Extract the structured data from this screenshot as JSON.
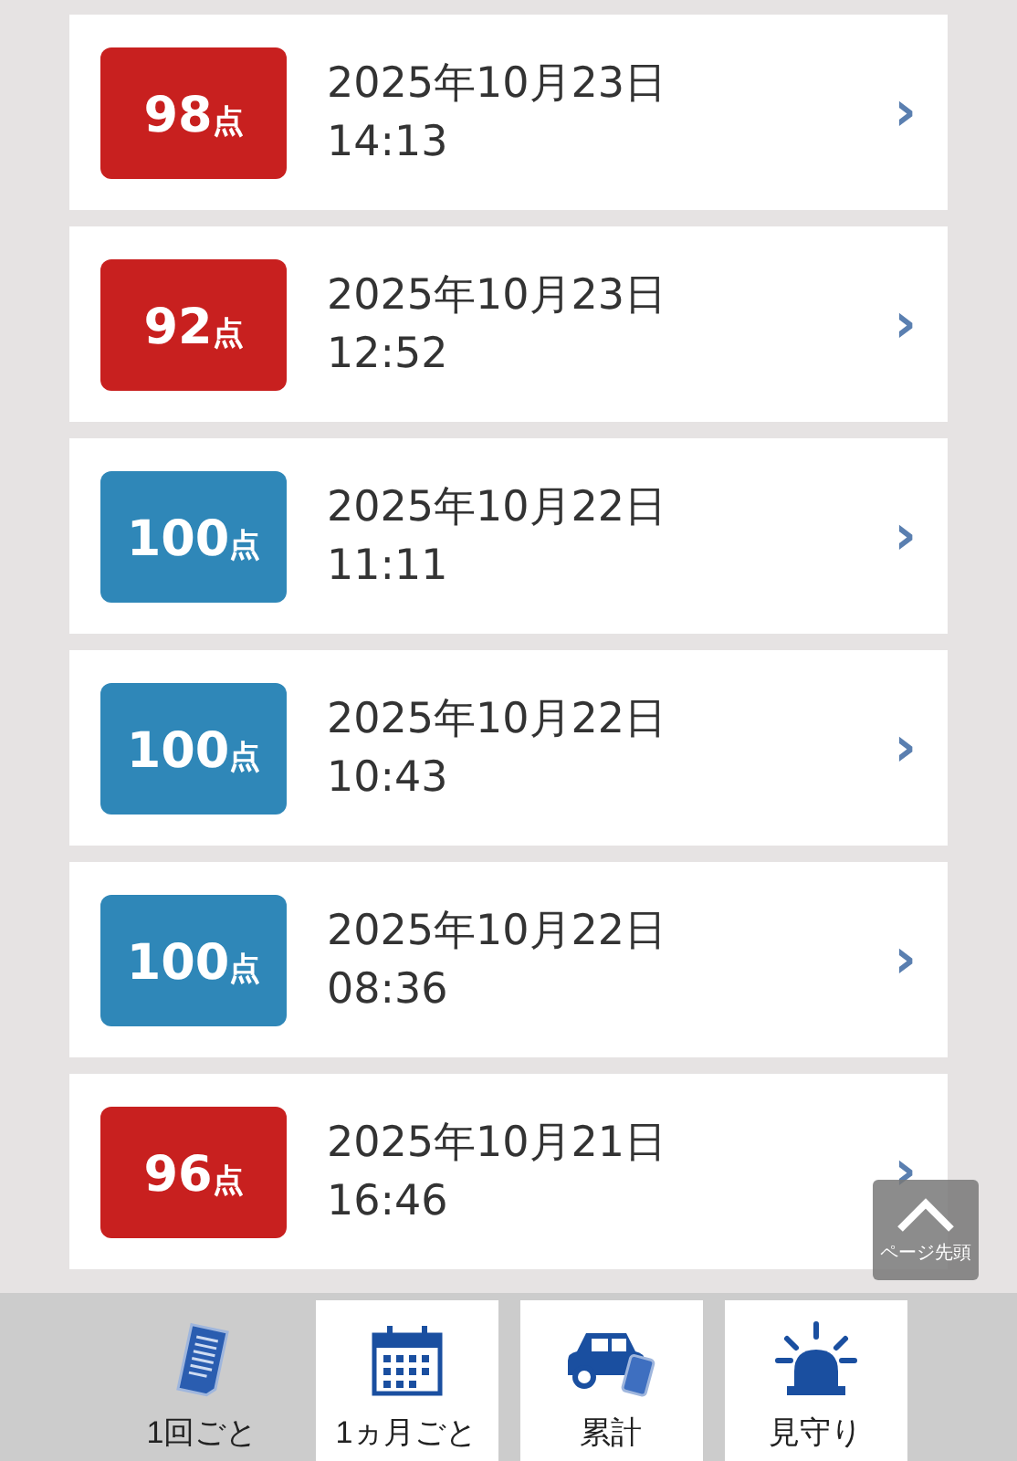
{
  "records": [
    {
      "score": "98",
      "unit": "点",
      "color": "#c8201f",
      "date": "2025年10月23日",
      "time": "14:13",
      "chevron": "›"
    },
    {
      "score": "92",
      "unit": "点",
      "color": "#c8201f",
      "date": "2025年10月23日",
      "time": "12:52",
      "chevron": "›"
    },
    {
      "score": "100",
      "unit": "点",
      "color": "#2f87b8",
      "date": "2025年10月22日",
      "time": "11:11",
      "chevron": "›"
    },
    {
      "score": "100",
      "unit": "点",
      "color": "#2f87b8",
      "date": "2025年10月22日",
      "time": "10:43",
      "chevron": "›"
    },
    {
      "score": "100",
      "unit": "点",
      "color": "#2f87b8",
      "date": "2025年10月22日",
      "time": "08:36",
      "chevron": "›"
    },
    {
      "score": "96",
      "unit": "点",
      "color": "#c8201f",
      "date": "2025年10月21日",
      "time": "16:46",
      "chevron": "›"
    }
  ],
  "page_top_button": {
    "label": "ページ先頭"
  },
  "bottom_nav": [
    {
      "kind": "document",
      "label": "1回ごと",
      "selected": true
    },
    {
      "kind": "calendar",
      "label": "1ヵ月ごと",
      "selected": false
    },
    {
      "kind": "car",
      "label": "累計",
      "selected": false
    },
    {
      "kind": "siren",
      "label": "見守り",
      "selected": false
    }
  ]
}
